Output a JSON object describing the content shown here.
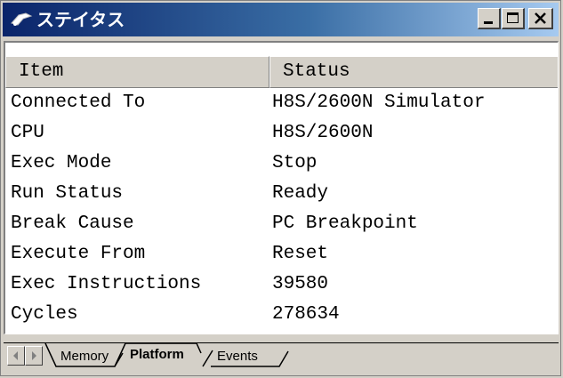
{
  "window": {
    "title": "ステイタス",
    "icon": "status-icon",
    "buttons": [
      "minimize",
      "maximize",
      "close"
    ]
  },
  "table": {
    "headers": [
      "Item",
      "Status"
    ],
    "rows": [
      {
        "item": "Connected To",
        "status": "H8S/2600N Simulator"
      },
      {
        "item": "CPU",
        "status": "H8S/2600N"
      },
      {
        "item": "Exec Mode",
        "status": "Stop"
      },
      {
        "item": "Run Status",
        "status": "Ready"
      },
      {
        "item": "Break Cause",
        "status": "PC Breakpoint"
      },
      {
        "item": "Execute From",
        "status": "Reset"
      },
      {
        "item": "Exec Instructions",
        "status": "39580"
      },
      {
        "item": "Cycles",
        "status": "278634"
      }
    ]
  },
  "tabs": [
    {
      "label": "Memory",
      "active": false
    },
    {
      "label": "Platform",
      "active": true
    },
    {
      "label": "Events",
      "active": false
    }
  ],
  "colors": {
    "titlebar_start": "#0a246a",
    "titlebar_end": "#a6caf0",
    "face": "#d4d0c8"
  }
}
